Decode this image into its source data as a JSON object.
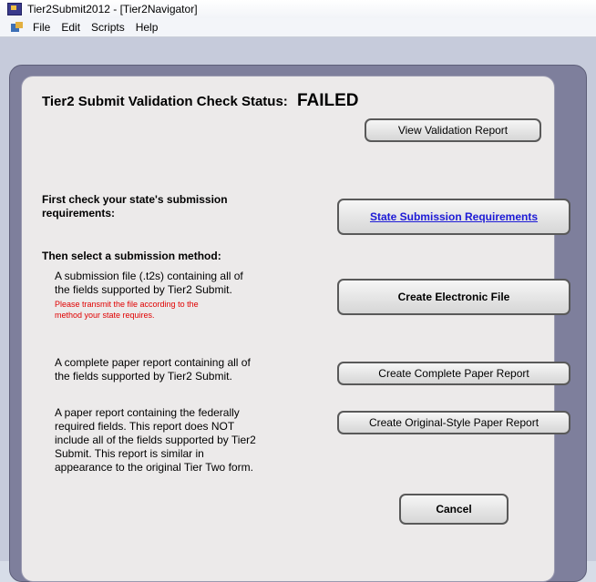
{
  "window": {
    "title": "Tier2Submit2012 - [Tier2Navigator]",
    "menu": [
      "File",
      "Edit",
      "Scripts",
      "Help"
    ]
  },
  "dialog": {
    "status_label": "Tier2 Submit Validation Check Status:",
    "status_value": "FAILED",
    "view_report_button": "View Validation Report",
    "check_label_line1": "First check your state's submission",
    "check_label_line2": "requirements:",
    "state_requirements_button": "State Submission Requirements",
    "method_label": "Then select a submission method:",
    "electronic": {
      "description_line1": "A submission file (.t2s) containing all of",
      "description_line2": "the fields supported by Tier2 Submit.",
      "note_line1": "Please transmit the file according to the",
      "note_line2": "method your state requires.",
      "button": "Create Electronic File"
    },
    "complete_paper": {
      "description_line1": "A complete paper report containing all of",
      "description_line2": "the  fields supported by Tier2 Submit.",
      "button": "Create Complete Paper Report"
    },
    "original_paper": {
      "description_line1": "A paper report containing the federally",
      "description_line2": "required fields.  This report does NOT",
      "description_line3": "include all of the fields supported by Tier2",
      "description_line4": "Submit.  This report is similar in",
      "description_line5": "appearance to the original Tier Two form.",
      "button": "Create Original-Style Paper Report"
    },
    "cancel_button": "Cancel"
  },
  "colors": {
    "failed_note": "#e00000",
    "link": "#1d1ad6",
    "outer_frame": "#7e7f9c",
    "panel": "#eceaea"
  }
}
